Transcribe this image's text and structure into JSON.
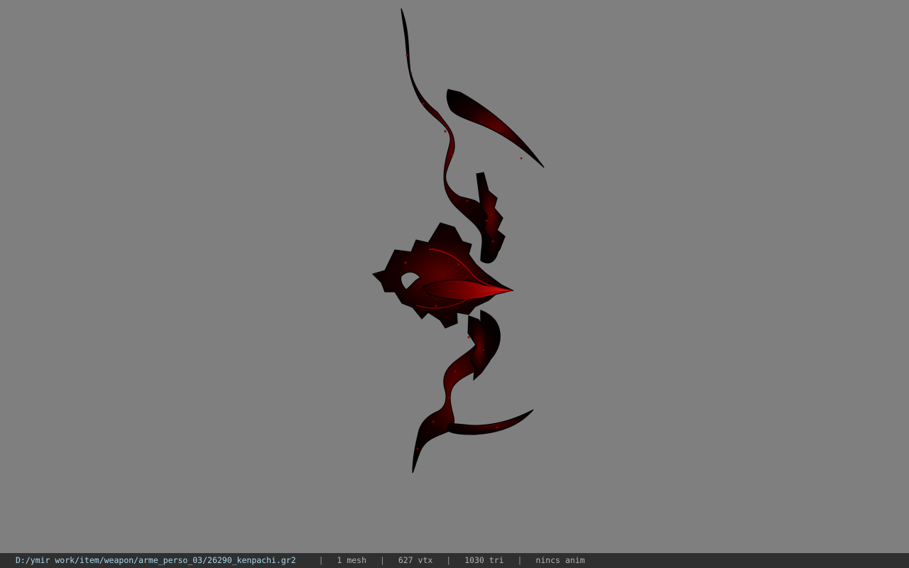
{
  "viewer": {
    "background_color": "#7f7f7f",
    "model_color_dark": "#090000",
    "model_color_accent": "#ff1a1a",
    "model_icon": "crossbow-model-icon"
  },
  "status_bar": {
    "file_path": "D:/ymir work/item/weapon/arme_perso_03/26290_kenpachi.gr2",
    "separator": "|",
    "mesh": "1 mesh",
    "vertices": "627 vtx",
    "triangles": "1030 tri",
    "animation": "nincs anim"
  }
}
